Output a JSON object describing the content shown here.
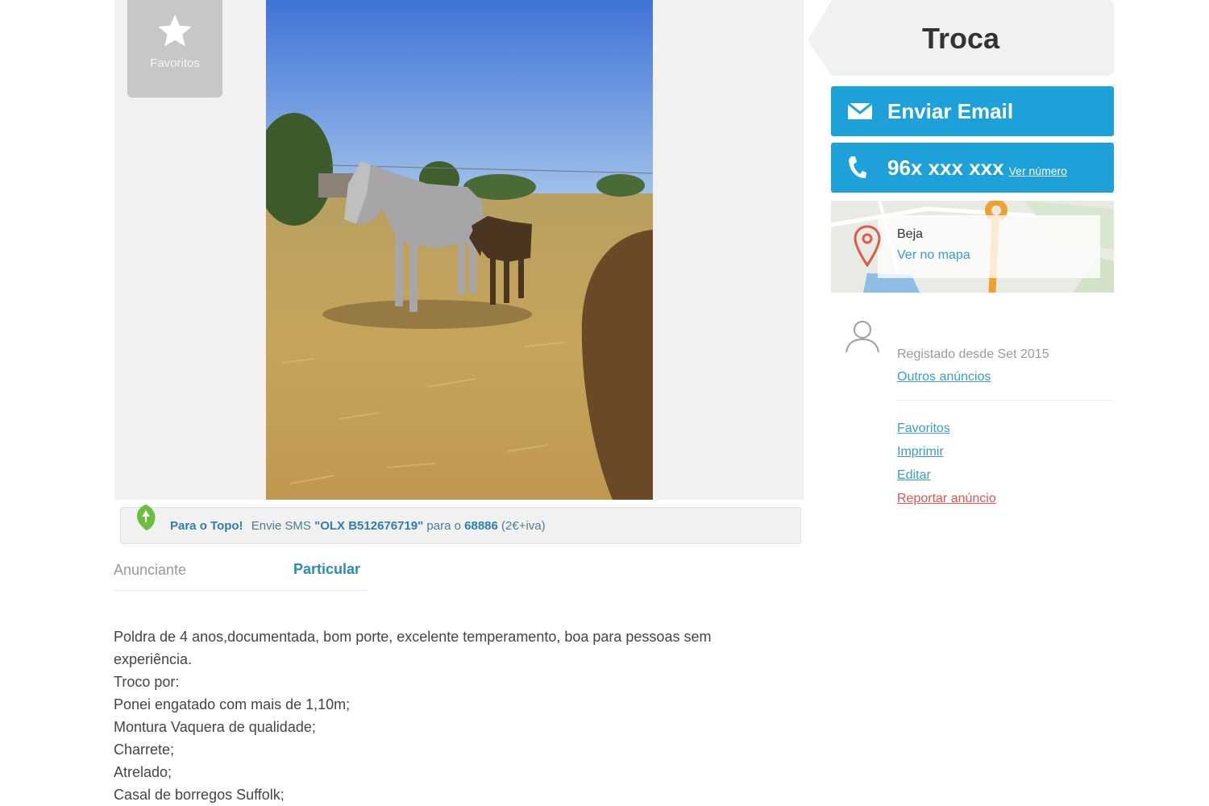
{
  "gallery": {
    "favorite_label": "Favoritos"
  },
  "promo": {
    "label": "Para o Topo!",
    "text1": "Envie SMS",
    "code": "\"OLX B512676719\"",
    "text2": "para o",
    "number": "68886",
    "price": "(2€+iva)"
  },
  "advertiser": {
    "label": "Anunciante",
    "value": "Particular"
  },
  "description": [
    "Poldra de 4 anos,documentada, bom porte, excelente temperamento, boa para pessoas sem experiência.",
    "Troco por:",
    "Ponei engatado com mais de 1,10m;",
    "Montura Vaquera de qualidade;",
    "Charrete;",
    "Atrelado;",
    "Casal de borregos Suffolk;"
  ],
  "sidebar": {
    "price": "Troca",
    "email_button": "Enviar Email",
    "phone_button": "96x xxx xxx",
    "phone_reveal": "Ver número",
    "map": {
      "city": "Beja",
      "link": "Ver no mapa"
    },
    "registered": "Registado desde Set 2015",
    "other_ads": "Outros anúncios",
    "actions": {
      "favorites": "Favoritos",
      "print": "Imprimir",
      "edit": "Editar",
      "report": "Reportar anúncio"
    }
  },
  "colors": {
    "accent": "#1ea0d8",
    "link": "#3b9bc9",
    "report": "#d9534f"
  }
}
